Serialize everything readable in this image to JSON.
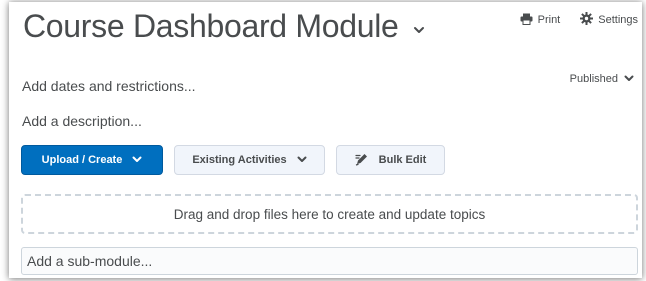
{
  "module": {
    "title": "Course Dashboard Module",
    "add_dates": "Add dates and restrictions...",
    "add_description": "Add a description...",
    "status": "Published"
  },
  "actions": {
    "print_label": "Print",
    "settings_label": "Settings"
  },
  "toolbar": {
    "upload_label": "Upload / Create",
    "existing_label": "Existing Activities",
    "bulk_edit_label": "Bulk Edit"
  },
  "dropzone": {
    "text": "Drag and drop files here to create and update topics"
  },
  "submodule": {
    "placeholder": "Add a sub-module..."
  },
  "colors": {
    "primary": "#006fbf",
    "text": "#494c4e",
    "secondary_bg": "#f1f5fb",
    "border": "#cdd5dc"
  },
  "icons": {
    "title_menu": "chevron-down-icon",
    "print": "printer-icon",
    "settings": "gear-icon",
    "status_menu": "chevron-down-icon",
    "bulk_edit": "pencil-icon"
  }
}
